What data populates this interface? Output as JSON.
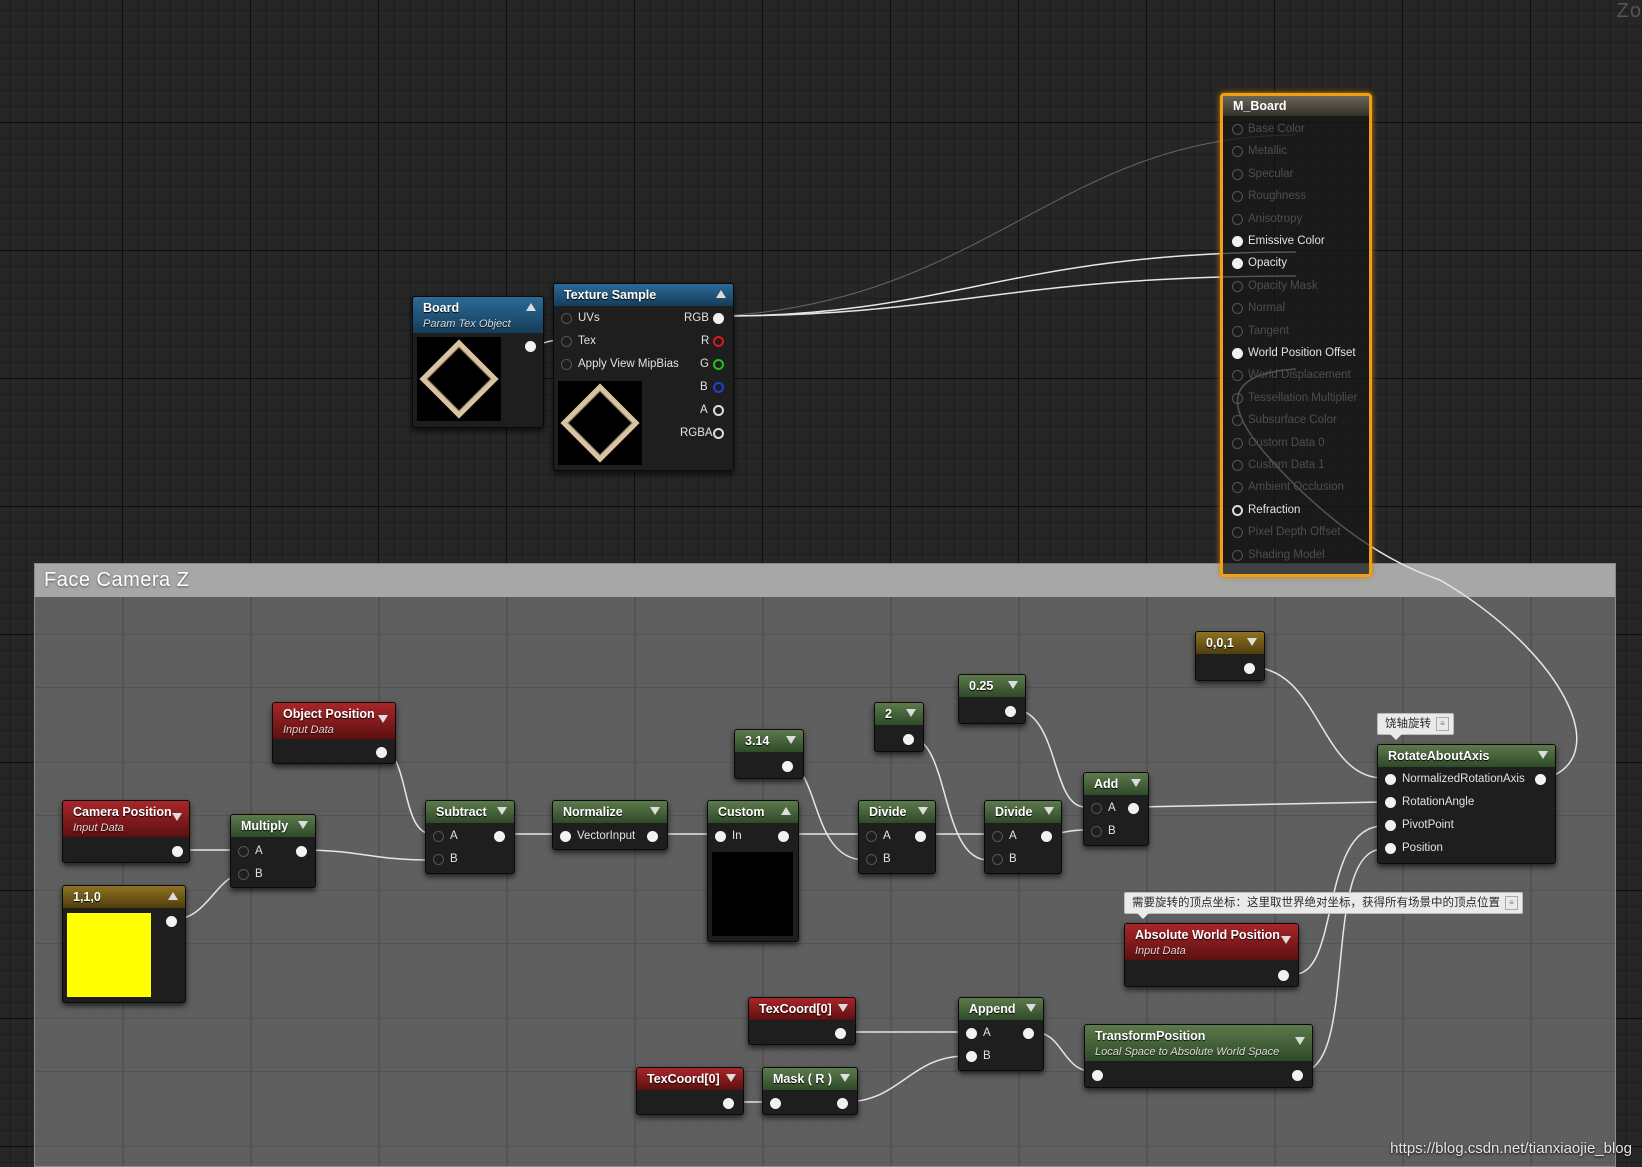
{
  "view": {
    "zoom_label": "Zo"
  },
  "comment": {
    "title": "Face  Camera Z"
  },
  "nodes": {
    "board": {
      "title": "Board",
      "subtitle": "Param Tex Object"
    },
    "texture_sample": {
      "title": "Texture Sample",
      "inputs": [
        "UVs",
        "Tex",
        "Apply View MipBias"
      ],
      "outputs": [
        "RGB",
        "R",
        "G",
        "B",
        "A",
        "RGBA"
      ]
    },
    "object_position": {
      "title": "Object Position",
      "subtitle": "Input Data"
    },
    "camera_position": {
      "title": "Camera Position",
      "subtitle": "Input Data"
    },
    "multiply": {
      "title": "Multiply",
      "inputs": [
        "A",
        "B"
      ]
    },
    "const_110": {
      "title": "1,1,0",
      "swatch": "#ffff00"
    },
    "subtract": {
      "title": "Subtract",
      "inputs": [
        "A",
        "B"
      ]
    },
    "normalize": {
      "title": "Normalize",
      "inputs": [
        "VectorInput"
      ]
    },
    "const_314": {
      "title": "3.14"
    },
    "custom": {
      "title": "Custom",
      "inputs": [
        "In"
      ]
    },
    "const_2": {
      "title": "2"
    },
    "divide1": {
      "title": "Divide",
      "inputs": [
        "A",
        "B"
      ]
    },
    "const_025": {
      "title": "0.25"
    },
    "divide2": {
      "title": "Divide",
      "inputs": [
        "A",
        "B"
      ]
    },
    "add": {
      "title": "Add",
      "inputs": [
        "A",
        "B"
      ]
    },
    "const_001": {
      "title": "0,0,1"
    },
    "rotate_about_axis": {
      "title": "RotateAboutAxis",
      "inputs": [
        "NormalizedRotationAxis",
        "RotationAngle",
        "PivotPoint",
        "Position"
      ]
    },
    "absolute_world_position": {
      "title": "Absolute World Position",
      "subtitle": "Input Data"
    },
    "texcoord_a": {
      "title": "TexCoord[0]"
    },
    "texcoord_b": {
      "title": "TexCoord[0]"
    },
    "mask_r": {
      "title": "Mask ( R )"
    },
    "append": {
      "title": "Append",
      "inputs": [
        "A",
        "B"
      ]
    },
    "transform_position": {
      "title": "TransformPosition",
      "subtitle": "Local Space to Absolute World Space"
    }
  },
  "tooltips": {
    "rotate": "饶轴旋转",
    "position": "需要旋转的顶点坐标：这里取世界绝对坐标，获得所有场景中的顶点位置"
  },
  "material_output": {
    "title": "M_Board",
    "pins": [
      {
        "label": "Base Color",
        "connected": false
      },
      {
        "label": "Metallic",
        "connected": false
      },
      {
        "label": "Specular",
        "connected": false
      },
      {
        "label": "Roughness",
        "connected": false
      },
      {
        "label": "Anisotropy",
        "connected": false
      },
      {
        "label": "Emissive Color",
        "connected": true
      },
      {
        "label": "Opacity",
        "connected": true
      },
      {
        "label": "Opacity Mask",
        "connected": false
      },
      {
        "label": "Normal",
        "connected": false
      },
      {
        "label": "Tangent",
        "connected": false
      },
      {
        "label": "World Position Offset",
        "connected": true
      },
      {
        "label": "World Displacement",
        "connected": false
      },
      {
        "label": "Tessellation Multiplier",
        "connected": false
      },
      {
        "label": "Subsurface Color",
        "connected": false
      },
      {
        "label": "Custom Data 0",
        "connected": false
      },
      {
        "label": "Custom Data 1",
        "connected": false
      },
      {
        "label": "Ambient Occlusion",
        "connected": false
      },
      {
        "label": "Refraction",
        "connected": true
      },
      {
        "label": "Pixel Depth Offset",
        "connected": false
      },
      {
        "label": "Shading Model",
        "connected": false
      }
    ]
  },
  "watermark": "https://blog.csdn.net/tianxiaojie_blog"
}
